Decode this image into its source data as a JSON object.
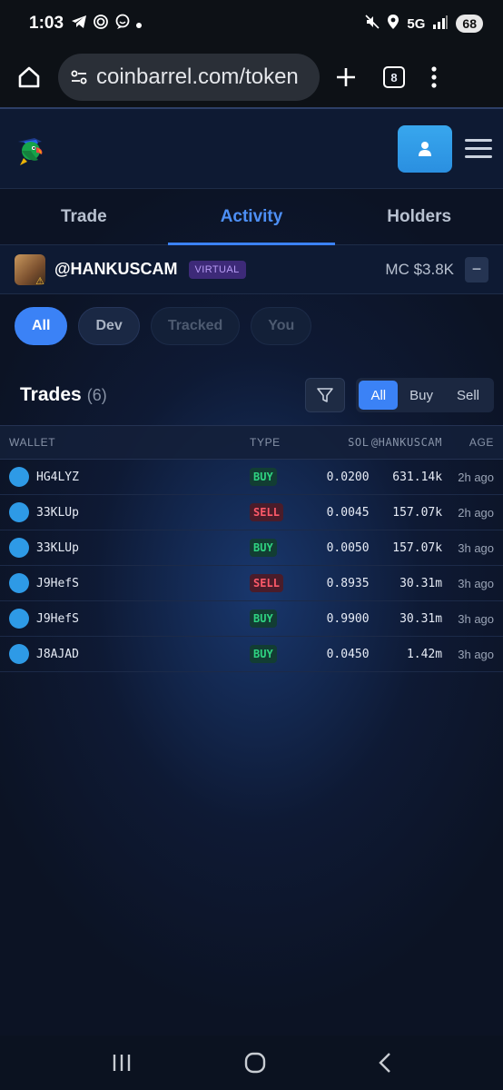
{
  "status_bar": {
    "time": "1:03",
    "network": "5G",
    "battery": "68"
  },
  "browser": {
    "url": "coinbarrel.com/token",
    "tab_count": "8"
  },
  "tabs": [
    {
      "label": "Trade"
    },
    {
      "label": "Activity"
    },
    {
      "label": "Holders"
    }
  ],
  "token": {
    "name": "@HANKUSCAM",
    "badge": "VIRTUAL",
    "market_cap": "MC $3.8K",
    "collapse": "−"
  },
  "filters": [
    {
      "label": "All"
    },
    {
      "label": "Dev"
    },
    {
      "label": "Tracked"
    },
    {
      "label": "You"
    }
  ],
  "trades": {
    "title": "Trades",
    "count": "(6)",
    "segments": [
      {
        "label": "All"
      },
      {
        "label": "Buy"
      },
      {
        "label": "Sell"
      }
    ],
    "columns": {
      "wallet": "WALLET",
      "type": "TYPE",
      "sol": "SOL",
      "token": "@HANKUSCAM",
      "age": "AGE"
    },
    "rows": [
      {
        "wallet": "HG4LYZ",
        "type": "BUY",
        "sol": "0.0200",
        "amount": "631.14k",
        "age": "2h ago"
      },
      {
        "wallet": "33KLUp",
        "type": "SELL",
        "sol": "0.0045",
        "amount": "157.07k",
        "age": "2h ago"
      },
      {
        "wallet": "33KLUp",
        "type": "BUY",
        "sol": "0.0050",
        "amount": "157.07k",
        "age": "3h ago"
      },
      {
        "wallet": "J9HefS",
        "type": "SELL",
        "sol": "0.8935",
        "amount": "30.31m",
        "age": "3h ago"
      },
      {
        "wallet": "J9HefS",
        "type": "BUY",
        "sol": "0.9900",
        "amount": "30.31m",
        "age": "3h ago"
      },
      {
        "wallet": "J8AJAD",
        "type": "BUY",
        "sol": "0.0450",
        "amount": "1.42m",
        "age": "3h ago"
      }
    ]
  },
  "colors": {
    "accent": "#3b82f6",
    "buy": "#2fd482",
    "sell": "#ff5a6a",
    "background": "#0c1324"
  }
}
